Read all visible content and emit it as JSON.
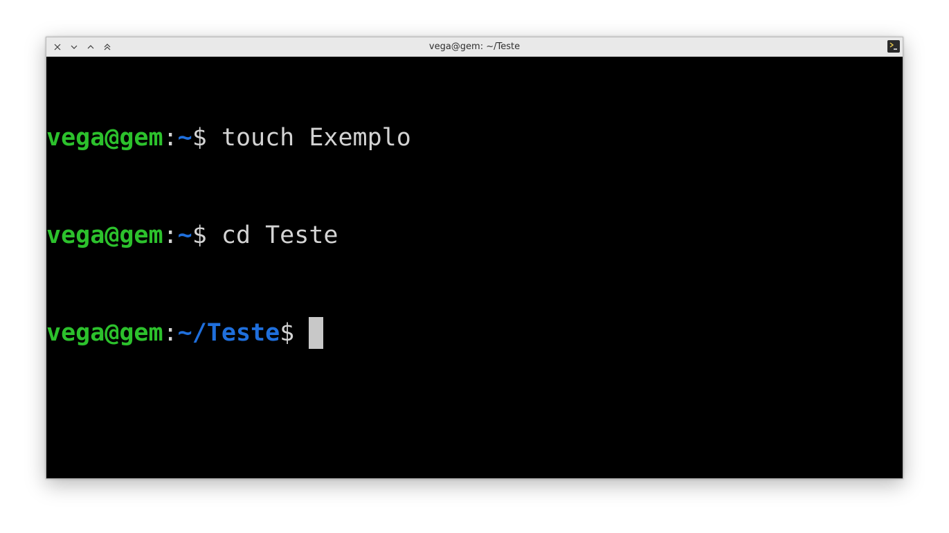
{
  "window": {
    "title": "vega@gem: ~/Teste",
    "buttons": [
      "close",
      "minimize",
      "maximize",
      "keep-above"
    ],
    "app_icon": "terminal-icon"
  },
  "terminal": {
    "lines": [
      {
        "user": "vega@gem",
        "sep": ":",
        "path": "~",
        "dollar": "$ ",
        "command": "touch Exemplo"
      },
      {
        "user": "vega@gem",
        "sep": ":",
        "path": "~",
        "dollar": "$ ",
        "command": "cd Teste"
      },
      {
        "user": "vega@gem",
        "sep": ":",
        "path": "~/Teste",
        "dollar": "$ ",
        "command": ""
      }
    ]
  },
  "colors": {
    "prompt_user": "#2cc12c",
    "prompt_path": "#1f6fdc",
    "text": "#d3d3d3",
    "background": "#000000"
  }
}
